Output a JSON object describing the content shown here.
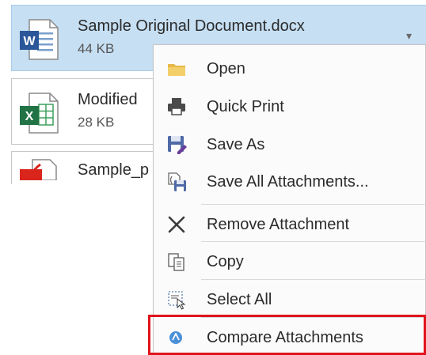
{
  "attachments": [
    {
      "name": "Sample Original Document.docx",
      "size": "44 KB",
      "icon": "word-file-icon",
      "selected": true
    },
    {
      "name": "Modified",
      "size": "28 KB",
      "icon": "excel-file-icon"
    },
    {
      "name": "Sample_p",
      "icon": "pdf-file-icon"
    }
  ],
  "context_menu": {
    "items": [
      {
        "label": "Open",
        "icon": "folder-icon"
      },
      {
        "label": "Quick Print",
        "icon": "printer-icon"
      },
      {
        "label": "Save As",
        "icon": "save-as-icon"
      },
      {
        "label": "Save All Attachments...",
        "icon": "save-all-icon"
      },
      {
        "label": "Remove Attachment",
        "icon": "close-x-icon"
      },
      {
        "label": "Copy",
        "icon": "copy-icon"
      },
      {
        "label": "Select All",
        "icon": "select-all-icon"
      },
      {
        "label": "Compare Attachments",
        "icon": "compare-icon"
      }
    ]
  },
  "colors": {
    "selected_bg": "#c6dff3",
    "highlight_border": "#e0141c",
    "word_blue": "#2b579a",
    "excel_green": "#217346",
    "pdf_red": "#d9251c"
  }
}
